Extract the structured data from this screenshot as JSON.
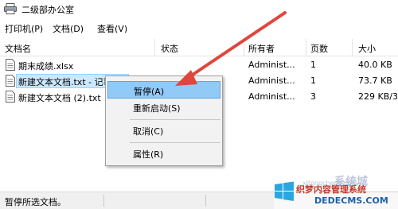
{
  "window": {
    "title": "二级部办公室"
  },
  "menu": [
    "打印机(P)",
    "文档(D)",
    "查看(V)"
  ],
  "columns": [
    "文档名",
    "状态",
    "所有者",
    "页数",
    "大小"
  ],
  "rows": [
    {
      "name": "期末成绩.xlsx",
      "status": "",
      "owner": "Administ...",
      "pages": "1",
      "size": "40.0 KB"
    },
    {
      "name": "新建文本文档.txt - 记事本",
      "status": "",
      "owner": "Administ...",
      "pages": "1",
      "size": "73.7 KB"
    },
    {
      "name": "新建文本文档 (2).txt",
      "status": "",
      "owner": "Administ...",
      "pages": "3",
      "size": "229 KB/3"
    }
  ],
  "context_menu": {
    "pause": "暂停(A)",
    "restart": "重新启动(S)",
    "cancel": "取消(C)",
    "properties": "属性(R)"
  },
  "status_bar": {
    "text": "暂停所选文档。"
  },
  "watermark": {
    "top": "系统城",
    "chinese": "织梦内容管理系统",
    "english": "DEDECMS.COM",
    "faint": "xitongcheng.com"
  },
  "colors": {
    "selection": "#cce8ff",
    "menu_highlight": "#91c9f7",
    "arrow": "#e0463c"
  }
}
